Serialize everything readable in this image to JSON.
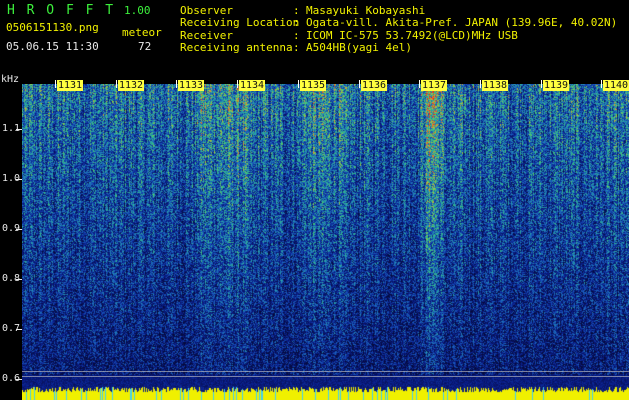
{
  "header": {
    "app_title": "H R O F F T",
    "version": "1.00",
    "filename": "0506151130.png",
    "mode": "meteor",
    "timestamp": "05.06.15 11:30",
    "count": "72"
  },
  "info": {
    "observer_label": "Observer",
    "observer_value": "Masayuki Kobayashi",
    "location_label": "Receiving Location",
    "location_value": "Ogata-vill. Akita-Pref. JAPAN (139.96E, 40.02N)",
    "receiver_label": "Receiver",
    "receiver_value": "ICOM IC-575 53.7492(@LCD)MHz USB",
    "antenna_label": "Receiving antenna",
    "antenna_value": "A504HB(yagi 4el)",
    "separator": ":"
  },
  "y_axis": {
    "unit": "kHz",
    "ticks": [
      "1.1",
      "1.0",
      "0.9",
      "0.8",
      "0.7",
      "0.6"
    ]
  },
  "x_axis": {
    "ticks": [
      "1131",
      "1132",
      "1133",
      "1134",
      "1135",
      "1136",
      "1137",
      "1138",
      "1139",
      "1140"
    ]
  },
  "colors": {
    "background": "#000000",
    "header_yellow": "#f2f200",
    "header_green": "#3cf03c",
    "tick_label_bg": "#ffff40",
    "spectrum_low": "#0a1a80",
    "spectrum_mid": "#2a8aa0",
    "spectrum_high": "#f02020",
    "baseline": "#f0f000"
  }
}
